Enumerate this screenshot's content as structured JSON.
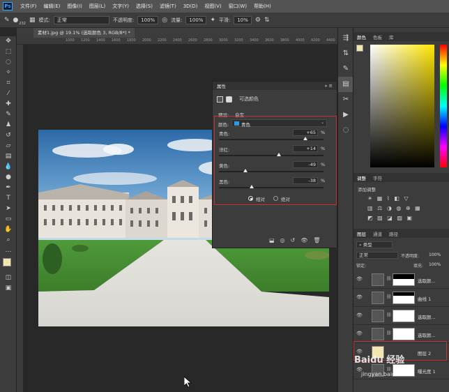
{
  "menu": {
    "logo": "Ps",
    "items": [
      "文件(F)",
      "编辑(E)",
      "图像(I)",
      "图层(L)",
      "文字(Y)",
      "选择(S)",
      "滤镜(T)",
      "3D(D)",
      "视图(V)",
      "窗口(W)",
      "帮助(H)"
    ]
  },
  "options": {
    "brush_size": "232",
    "mode_label": "模式:",
    "mode_value": "正常",
    "opacity_label": "不透明度:",
    "opacity_value": "100%",
    "flow_label": "流量:",
    "flow_value": "100%",
    "smooth_label": "平滑:",
    "smooth_value": "10%"
  },
  "document_tab": "素材1.jpg @ 19.1% (选取颜色 3, RGB/8*) *",
  "ruler_ticks": [
    "1000",
    "1200",
    "1400",
    "1600",
    "1800",
    "2000",
    "2200",
    "2400",
    "2600",
    "2800",
    "3000",
    "3200",
    "3400",
    "3600",
    "3800",
    "4000",
    "4200",
    "4400"
  ],
  "properties": {
    "title": "属性",
    "subtitle": "可选颜色",
    "preset_label": "预设:",
    "preset_value": "自定",
    "colors_label": "颜色:",
    "colors_value": "青色",
    "sliders": [
      {
        "label": "青色:",
        "value": "+65",
        "pos": 0.825
      },
      {
        "label": "洋红:",
        "value": "+14",
        "pos": 0.57
      },
      {
        "label": "黄色:",
        "value": "-49",
        "pos": 0.255
      },
      {
        "label": "黑色:",
        "value": "-38",
        "pos": 0.31
      }
    ],
    "unit": "%",
    "radio_relative": "相对",
    "radio_absolute": "绝对"
  },
  "color_panel": {
    "tabs": [
      "颜色",
      "色板",
      "库"
    ]
  },
  "adjust_panel": {
    "tabs": [
      "调整",
      "字符"
    ],
    "add_label": "添加调整"
  },
  "layers_panel": {
    "tabs": [
      "图层",
      "通道",
      "路径"
    ],
    "kind_label": "类型",
    "blend_mode": "正常",
    "opacity_label": "不透明度:",
    "opacity_value": "100%",
    "lock_label": "锁定:",
    "fill_label": "填充:",
    "fill_value": "100%",
    "layers": [
      {
        "name": "选取颜..."
      },
      {
        "name": "曲线 1"
      },
      {
        "name": "选取颜..."
      },
      {
        "name": "选取颜..."
      },
      {
        "name": "图层 2"
      },
      {
        "name": "曝光度 1"
      }
    ]
  },
  "watermark": {
    "text": "Baidu 经验",
    "url": "jingyan.baidu.com"
  }
}
